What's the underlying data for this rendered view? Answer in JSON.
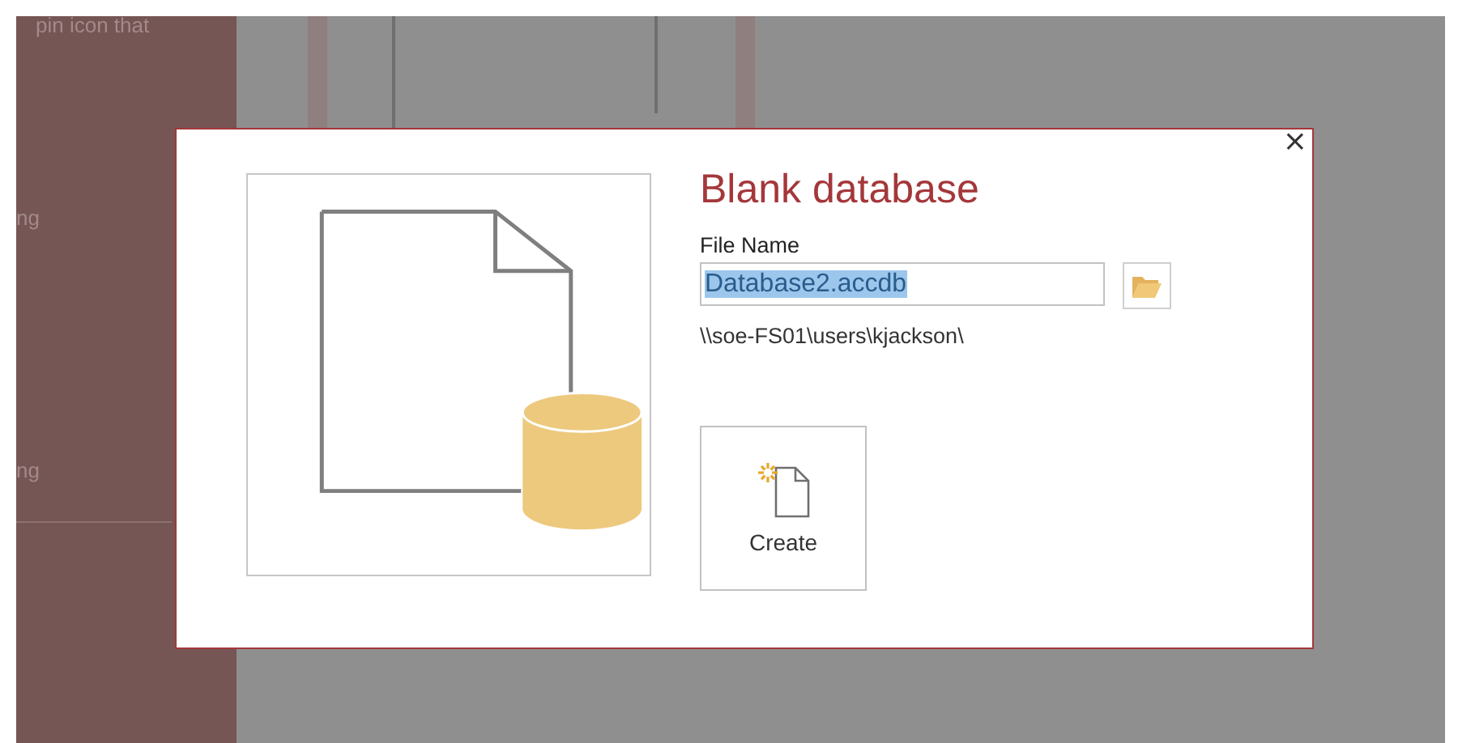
{
  "background": {
    "sidebar_items": [
      "pin icon that",
      "ng",
      "ng"
    ]
  },
  "dialog": {
    "title": "Blank database",
    "close": "×",
    "file_name": {
      "label": "File Name",
      "value": "Database2.accdb",
      "text_selected": true
    },
    "path": "\\\\soe-FS01\\users\\kjackson\\",
    "create_button": "Create"
  }
}
